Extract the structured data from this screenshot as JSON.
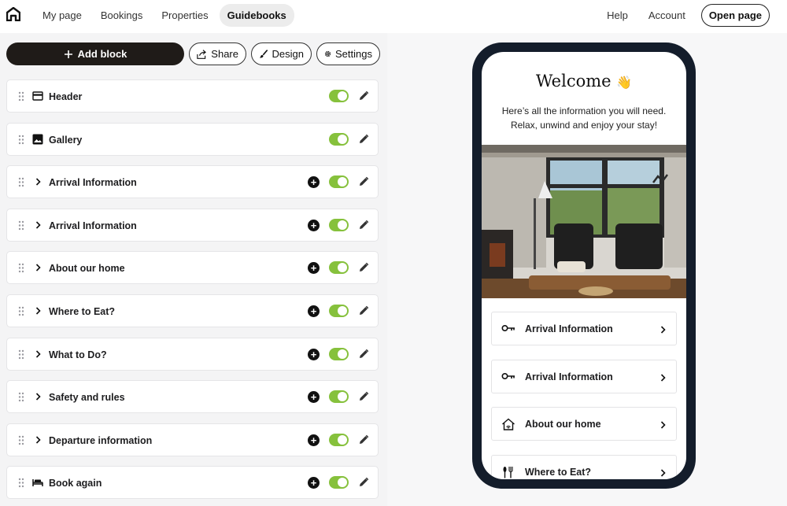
{
  "nav": {
    "left_items": [
      {
        "label": "My page",
        "active": false
      },
      {
        "label": "Bookings",
        "active": false
      },
      {
        "label": "Properties",
        "active": false
      },
      {
        "label": "Guidebooks",
        "active": true
      }
    ],
    "help": "Help",
    "account": "Account",
    "open_page": "Open page"
  },
  "toolbar": {
    "add_block": "Add block",
    "share": "Share",
    "design": "Design",
    "settings": "Settings"
  },
  "blocks": [
    {
      "label": "Header",
      "icon": "header-icon",
      "expandable": false,
      "addable": false,
      "enabled": true
    },
    {
      "label": "Gallery",
      "icon": "image-icon",
      "expandable": false,
      "addable": false,
      "enabled": true
    },
    {
      "label": "Arrival Information",
      "icon": "chevron-right-icon",
      "expandable": true,
      "addable": true,
      "enabled": true
    },
    {
      "label": "Arrival Information",
      "icon": "chevron-right-icon",
      "expandable": true,
      "addable": true,
      "enabled": true
    },
    {
      "label": "About our home",
      "icon": "chevron-right-icon",
      "expandable": true,
      "addable": true,
      "enabled": true
    },
    {
      "label": "Where to Eat?",
      "icon": "chevron-right-icon",
      "expandable": true,
      "addable": true,
      "enabled": true
    },
    {
      "label": "What to Do?",
      "icon": "chevron-right-icon",
      "expandable": true,
      "addable": true,
      "enabled": true
    },
    {
      "label": "Safety and rules",
      "icon": "chevron-right-icon",
      "expandable": true,
      "addable": true,
      "enabled": true
    },
    {
      "label": "Departure information",
      "icon": "chevron-right-icon",
      "expandable": true,
      "addable": true,
      "enabled": true
    },
    {
      "label": "Book again",
      "icon": "bed-icon",
      "expandable": false,
      "addable": true,
      "enabled": true
    }
  ],
  "preview": {
    "title": "Welcome",
    "title_emoji": "👋",
    "intro_line1": "Here’s all the information you will need.",
    "intro_line2": "Relax, unwind and enjoy your stay!",
    "cards": [
      {
        "label": "Arrival Information",
        "icon": "key-icon"
      },
      {
        "label": "Arrival Information",
        "icon": "key-icon"
      },
      {
        "label": "About our home",
        "icon": "smart-home-icon"
      },
      {
        "label": "Where to Eat?",
        "icon": "cutlery-icon"
      }
    ]
  },
  "colors": {
    "toggle_on": "#86c13c",
    "primary_dark": "#1f1b18",
    "phone_frame": "#141d2b"
  }
}
